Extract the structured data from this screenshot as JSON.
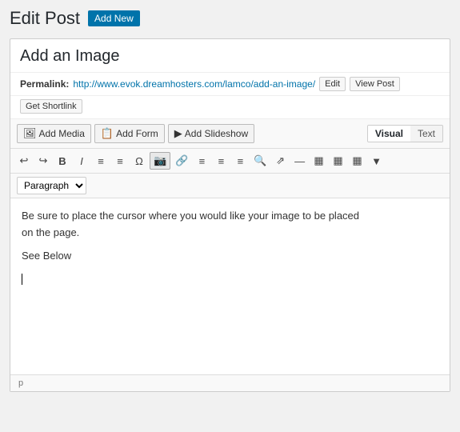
{
  "header": {
    "title": "Edit Post",
    "add_new_label": "Add New"
  },
  "post": {
    "title": "Add an Image",
    "permalink_label": "Permalink:",
    "permalink_url": "http://www.evok.dreamhosters.com/lamco/add-an-image/",
    "edit_btn": "Edit",
    "view_post_btn": "View Post",
    "shortlink_btn": "Get Shortlink"
  },
  "toolbar": {
    "add_media_label": "Add Media",
    "add_form_label": "Add Form",
    "add_slideshow_label": "Add Slideshow",
    "visual_tab": "Visual",
    "text_tab": "Text"
  },
  "editor_toolbar": {
    "undo": "↩",
    "redo": "↪",
    "bold": "B",
    "italic": "I",
    "ul": "≡",
    "ol": "≡",
    "special": "Ω",
    "image": "🖼",
    "link": "🔗",
    "align_left": "≡",
    "align_center": "≡",
    "align_right": "≡",
    "search": "🔍",
    "expand": "⊞",
    "minus": "—",
    "table1": "▦",
    "table2": "▦",
    "table3": "▦",
    "more": "▼",
    "paragraph_default": "Paragraph"
  },
  "content": {
    "line1": "Be sure to place the cursor where you would like your image to be placed",
    "line2": "on the page.",
    "line3": "See Below",
    "cursor_line": true
  },
  "footer": {
    "tag": "p"
  }
}
